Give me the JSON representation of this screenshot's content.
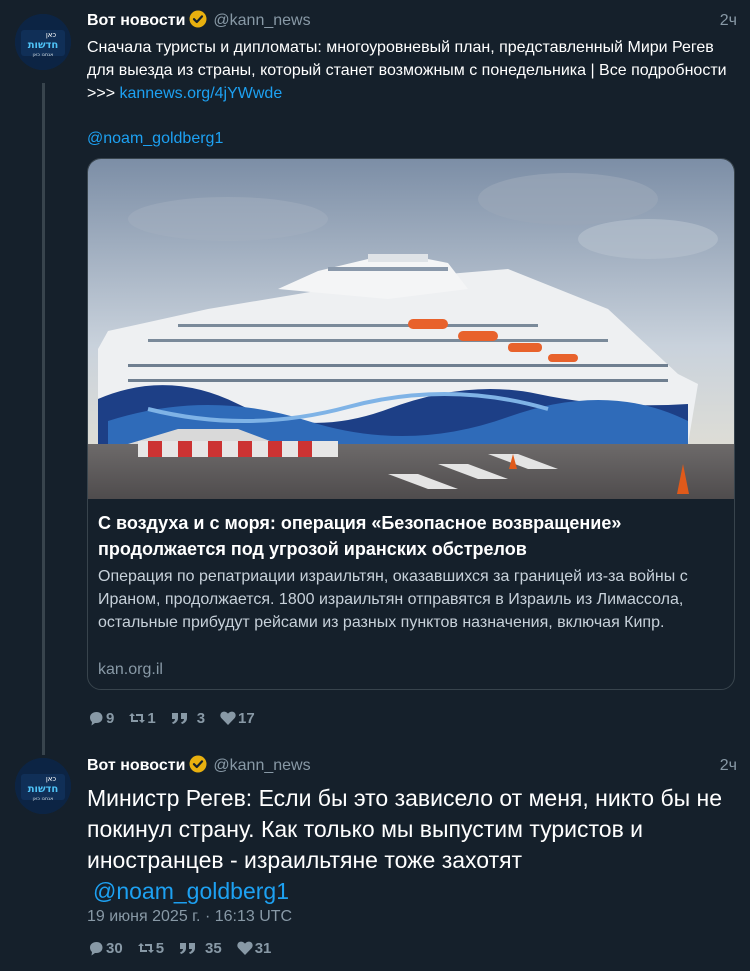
{
  "tweet1": {
    "display_name": "Вот новости",
    "handle": "@kann_news",
    "time": "2ч",
    "text": "Сначала туристы и дипломаты: многоуровневый план, представленный Мири Регев для выезда из страны, который станет возможным с понедельника | Все подробности >>> ",
    "link": "kannews.org/4jYWwde",
    "mention": "@noam_goldberg1",
    "card": {
      "title": "С воздуха и с моря: операция «Безопасное возвращение» продолжается под угрозой иранских обстрелов",
      "description": "Операция по репатриации израильтян, оказавшихся за границей из-за войны с Ираном, продолжается. 1800 израильтян отправятся в Израиль из Лимассола, остальные прибудут рейсами из разных пунктов назначения, включая Кипр.",
      "domain": "kan.org.il",
      "image_alt": "Круизный лайнер у причала"
    },
    "stats": {
      "replies": "9",
      "retweets": "1",
      "quotes": "3",
      "likes": "17"
    }
  },
  "tweet2": {
    "display_name": "Вот новости",
    "handle": "@kann_news",
    "time": "2ч",
    "text": "Министр Регев: Если бы это зависело от меня, никто бы не покинул страну. Как только мы выпустим туристов и иностранцев - израильтяне тоже захотят",
    "mention": "@noam_goldberg1",
    "date": "19 июня 2025 г. · 16:13 UTC",
    "stats": {
      "replies": "30",
      "retweets": "5",
      "quotes": "35",
      "likes": "31"
    }
  },
  "avatar": {
    "line1": "כאן",
    "line2": "חדשות",
    "line3": "אנחנו כאן"
  },
  "colors": {
    "background": "#15202b",
    "link": "#1da1f2",
    "muted": "#8899a6",
    "verified": "#e8b00f"
  },
  "icons": [
    "verified-badge-icon",
    "reply-icon",
    "retweet-icon",
    "quote-icon",
    "like-icon"
  ]
}
